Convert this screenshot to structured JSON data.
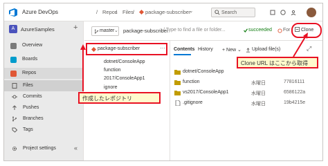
{
  "header": {
    "brand": "Azure DevOps",
    "breadcrumbs": [
      "/",
      "Repos",
      "/",
      "Files",
      "/",
      "package-subscriber",
      "⌄"
    ],
    "search_placeholder": "Search"
  },
  "sidebar": {
    "project_badge": "A",
    "project_name": "AzureSamples",
    "add_label": "+",
    "items": [
      {
        "label": "Overview",
        "color": "#7a7a7a"
      },
      {
        "label": "Boards",
        "color": "#009ccc"
      },
      {
        "label": "Repos",
        "color": "#e05735"
      }
    ],
    "subitems": [
      {
        "label": "Files"
      },
      {
        "label": "Commits"
      },
      {
        "label": "Pushes"
      },
      {
        "label": "Branches"
      },
      {
        "label": "Tags"
      }
    ],
    "settings_label": "Project settings",
    "collapse_label": "«"
  },
  "toolbar": {
    "branch_label": "master",
    "branch_caret": "⌄",
    "repo_name": "package-subscriber",
    "path_hint": "/ Type to find a file or folder...",
    "status": "succeeded",
    "fork_label": "For",
    "clone_label": "Clone"
  },
  "tree": {
    "root_label": "package-subscriber",
    "more_label": "···",
    "items": [
      "dotnet/ConsoleApp",
      "function",
      "2017/ConsoleApp1",
      "ignore"
    ]
  },
  "content": {
    "tabs": [
      "Contents",
      "History"
    ],
    "new_label": "+ New ⌄",
    "upload_label": "Upload file(s)",
    "expand_label": "⤢",
    "files": [
      {
        "name": "dotnet/ConsoleApp",
        "date": "",
        "commit": "",
        "type": "folder"
      },
      {
        "name": "function",
        "date": "水曜日",
        "commit": "77816111",
        "type": "folder"
      },
      {
        "name": "vs2017/ConsoleApp1",
        "date": "水曜日",
        "commit": "6586122a",
        "type": "folder"
      },
      {
        "name": ".gitignore",
        "date": "水曜日",
        "commit": "19b4215e",
        "type": "file"
      }
    ]
  },
  "callouts": {
    "created_repo": "作成したレポジトリ",
    "clone_url": "Clone URL はここから取得"
  },
  "colors": {
    "accent": "#0078d4",
    "highlight": "#e81123",
    "callout_bg": "#fffacd"
  }
}
